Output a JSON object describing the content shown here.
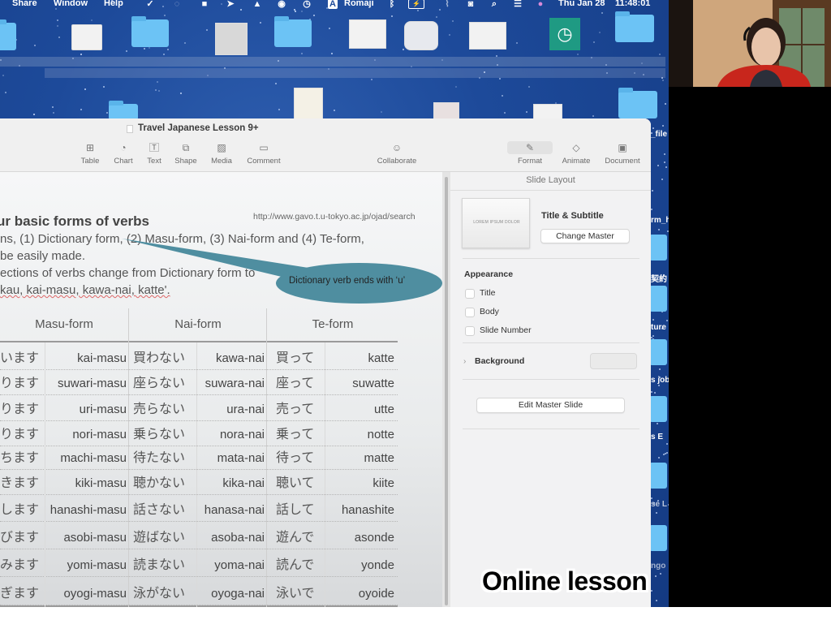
{
  "menubar": {
    "items": [
      "Share",
      "Window",
      "Help"
    ],
    "status_icons": [
      "checkmark-circle-icon",
      "spinner-icon",
      "shield-check-icon",
      "arrow-bundle-icon",
      "vlc-cone-icon",
      "record-icon",
      "time-machine-icon",
      "input-source-icon",
      "bluetooth-icon",
      "battery-icon",
      "wifi-icon",
      "user-icon",
      "search-icon",
      "control-center-icon",
      "siri-icon"
    ],
    "input_source_badge": "A",
    "input_source": "Romaji",
    "date": "Thu Jan 28",
    "time": "11:48:01"
  },
  "desktop": {
    "side_labels": [
      "_file",
      "rm_h",
      "契約",
      "ture",
      "s job",
      "s E",
      "se L",
      "ngo"
    ]
  },
  "keynote": {
    "document_title": "Travel Japanese Lesson 9+",
    "toolbar": [
      {
        "label": "Table",
        "icon": "table-icon"
      },
      {
        "label": "Chart",
        "icon": "chart-icon"
      },
      {
        "label": "Text",
        "icon": "text-icon"
      },
      {
        "label": "Shape",
        "icon": "shape-icon"
      },
      {
        "label": "Media",
        "icon": "media-icon"
      },
      {
        "label": "Comment",
        "icon": "comment-icon"
      },
      {
        "label": "Collaborate",
        "icon": "collaborate-icon"
      },
      {
        "label": "Format",
        "icon": "format-brush-icon",
        "active": true
      },
      {
        "label": "Animate",
        "icon": "animate-diamond-icon"
      },
      {
        "label": "Document",
        "icon": "document-icon"
      }
    ],
    "slide": {
      "title": "ur basic forms of verbs",
      "source_url": "http://www.gavo.t.u-tokyo.ac.jp/ojad/search",
      "body_lines": [
        "ns, (1) Dictionary form, (2) Masu-form, (3) Nai-form and (4) Te-form,",
        " be easily made.",
        "ections of verbs change from Dictionary form to",
        "kau, kai-masu, kawa-nai, katte'."
      ],
      "callout": "Dictionary verb ends with ‘u’",
      "table": {
        "headers": [
          "Masu-form",
          "Nai-form",
          "Te-form"
        ],
        "rows": [
          [
            "います",
            "kai-masu",
            "買わない",
            "kawa-nai",
            "買って",
            "katte"
          ],
          [
            "ります",
            "suwari-masu",
            "座らない",
            "suwara-nai",
            "座って",
            "suwatte"
          ],
          [
            "ります",
            "uri-masu",
            "売らない",
            "ura-nai",
            "売って",
            "utte"
          ],
          [
            "ります",
            "nori-masu",
            "乗らない",
            "nora-nai",
            "乗って",
            "notte"
          ],
          [
            "ちます",
            "machi-masu",
            "待たない",
            "mata-nai",
            "待って",
            "matte"
          ],
          [
            "きます",
            "kiki-masu",
            "聴かない",
            "kika-nai",
            "聴いて",
            "kiite"
          ],
          [
            "します",
            "hanashi-masu",
            "話さない",
            "hanasa-nai",
            "話して",
            "hanashite"
          ],
          [
            "びます",
            "asobi-masu",
            "遊ばない",
            "asoba-nai",
            "遊んで",
            "asonde"
          ],
          [
            "みます",
            "yomi-masu",
            "読まない",
            "yoma-nai",
            "読んで",
            "yonde"
          ],
          [
            "ぎます",
            "oyogi-masu",
            "泳がない",
            "oyoga-nai",
            "泳いで",
            "oyoide"
          ]
        ]
      }
    },
    "inspector": {
      "title": "Slide Layout",
      "master_thumbnail_text": "LOREM IPSUM DOLOR",
      "master_name": "Title & Subtitle",
      "change_master_label": "Change Master",
      "appearance_label": "Appearance",
      "checkboxes": [
        {
          "label": "Title",
          "checked": false
        },
        {
          "label": "Body",
          "checked": false
        },
        {
          "label": "Slide Number",
          "checked": false
        }
      ],
      "background_label": "Background",
      "edit_master_label": "Edit Master Slide"
    }
  },
  "caption": "Online lesson",
  "colors": {
    "callout": "#4f8ea0",
    "desktop": "#1d4a9a",
    "folder": "#6cc3f5"
  }
}
